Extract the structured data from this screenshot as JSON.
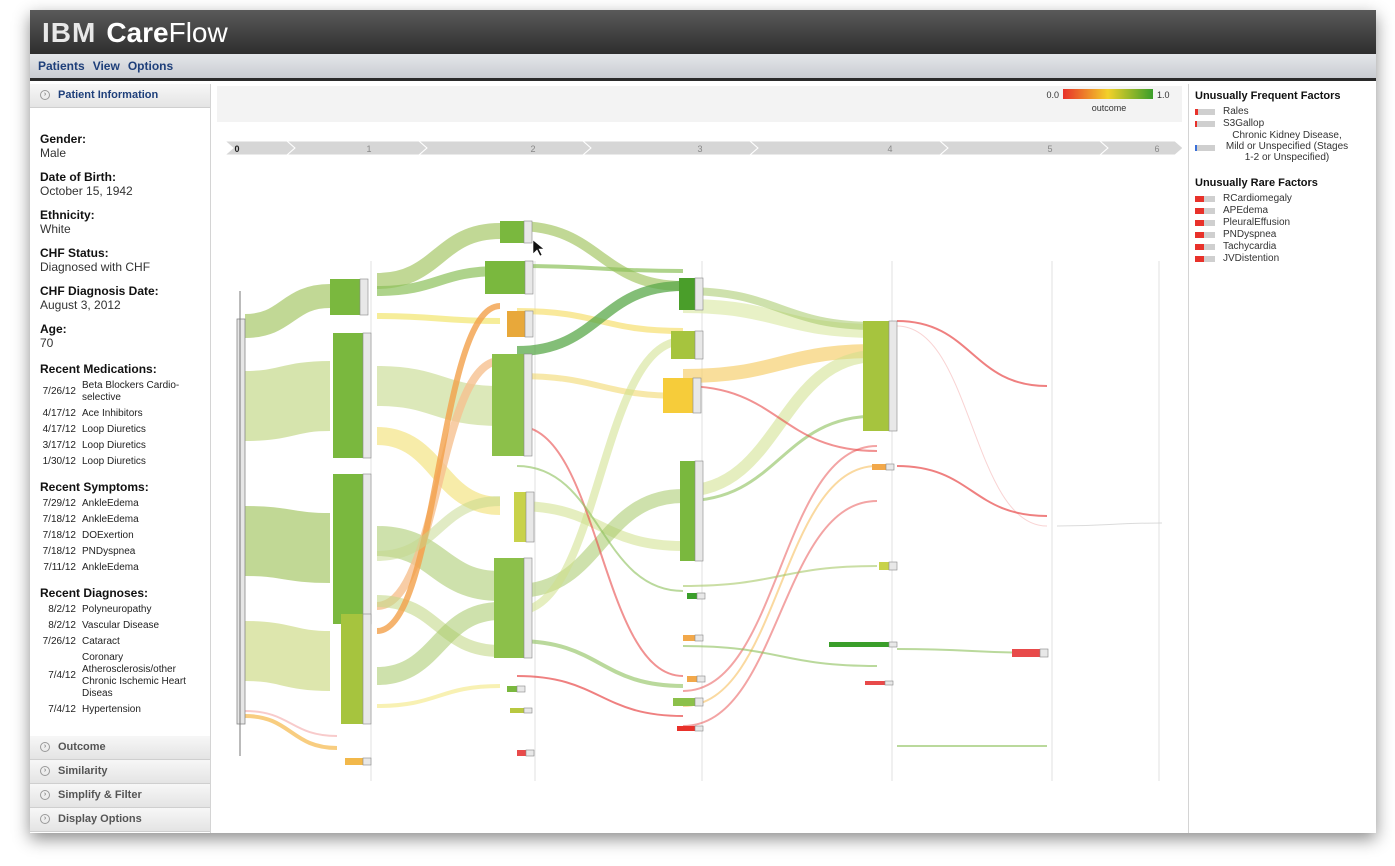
{
  "app": {
    "brand_ibm": "IBM",
    "brand_care": "Care",
    "brand_flow": "Flow"
  },
  "menu": [
    "Patients",
    "View",
    "Options"
  ],
  "left_panel": {
    "section_title": "Patient Information",
    "fields": [
      {
        "label": "Gender:",
        "value": "Male"
      },
      {
        "label": "Date of Birth:",
        "value": "October 15, 1942"
      },
      {
        "label": "Ethnicity:",
        "value": "White"
      },
      {
        "label": "CHF Status:",
        "value": "Diagnosed with CHF"
      },
      {
        "label": "CHF Diagnosis Date:",
        "value": "August 3, 2012"
      },
      {
        "label": "Age:",
        "value": "70"
      }
    ],
    "medications_title": "Recent Medications:",
    "medications": [
      {
        "date": "7/26/12",
        "text": "Beta Blockers Cardio-selective"
      },
      {
        "date": "4/17/12",
        "text": "Ace Inhibitors"
      },
      {
        "date": "4/17/12",
        "text": "Loop Diuretics"
      },
      {
        "date": "3/17/12",
        "text": "Loop Diuretics"
      },
      {
        "date": "1/30/12",
        "text": "Loop Diuretics"
      }
    ],
    "symptoms_title": "Recent Symptoms:",
    "symptoms": [
      {
        "date": "7/29/12",
        "text": "AnkleEdema"
      },
      {
        "date": "7/18/12",
        "text": "AnkleEdema"
      },
      {
        "date": "7/18/12",
        "text": "DOExertion"
      },
      {
        "date": "7/18/12",
        "text": "PNDyspnea"
      },
      {
        "date": "7/11/12",
        "text": "AnkleEdema"
      }
    ],
    "diagnoses_title": "Recent Diagnoses:",
    "diagnoses": [
      {
        "date": "8/2/12",
        "text": "Polyneuropathy"
      },
      {
        "date": "8/2/12",
        "text": "Vascular Disease"
      },
      {
        "date": "7/26/12",
        "text": "Cataract"
      },
      {
        "date": "7/4/12",
        "text": "Coronary Atherosclerosis/other Chronic Ischemic Heart Diseas"
      },
      {
        "date": "7/4/12",
        "text": "Hypertension"
      }
    ],
    "collapsed_sections": [
      "Outcome",
      "Similarity",
      "Simplify & Filter",
      "Display Options"
    ]
  },
  "legend": {
    "min_label": "0.0",
    "max_label": "1.0",
    "title": "outcome",
    "color_low": "#e8312a",
    "color_mid": "#f2d12a",
    "color_high": "#3a9e2a"
  },
  "timeline": {
    "steps": [
      "0",
      "1",
      "2",
      "3",
      "4",
      "5",
      "6"
    ],
    "selected_step": "0"
  },
  "right_panel": {
    "frequent_title": "Unusually Frequent Factors",
    "frequent": [
      {
        "label": "Rales",
        "color": "#e8312a",
        "fill": 0.15
      },
      {
        "label": "S3Gallop",
        "color": "#e8312a",
        "fill": 0.1
      },
      {
        "label": "Chronic Kidney Disease, Mild or Unspecified (Stages 1-2 or Unspecified)",
        "color": "#3a6fd8",
        "fill": 0.1
      }
    ],
    "rare_title": "Unusually Rare Factors",
    "rare": [
      {
        "label": "RCardiomegaly",
        "color": "#e8312a",
        "fill": 0.45
      },
      {
        "label": "APEdema",
        "color": "#e8312a",
        "fill": 0.45
      },
      {
        "label": "PleuralEffusion",
        "color": "#e8312a",
        "fill": 0.45
      },
      {
        "label": "PNDyspnea",
        "color": "#e8312a",
        "fill": 0.45
      },
      {
        "label": "Tachycardia",
        "color": "#e8312a",
        "fill": 0.45
      },
      {
        "label": "JVDistention",
        "color": "#e8312a",
        "fill": 0.45
      }
    ]
  }
}
